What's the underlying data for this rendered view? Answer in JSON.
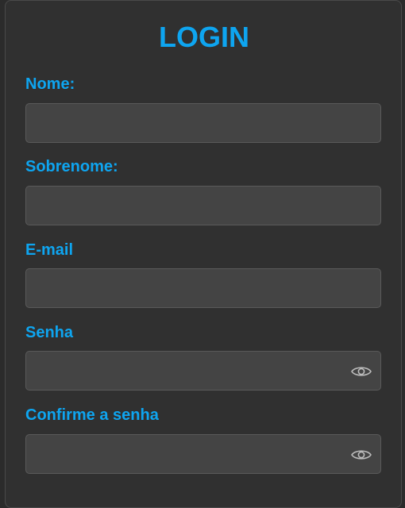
{
  "form": {
    "title": "LOGIN",
    "fields": [
      {
        "label": "Nome:",
        "value": "",
        "placeholder": ""
      },
      {
        "label": "Sobrenome:",
        "value": "",
        "placeholder": ""
      },
      {
        "label": "E-mail",
        "value": "",
        "placeholder": ""
      },
      {
        "label": "Senha",
        "value": "",
        "placeholder": "",
        "toggle_icon": "eye-icon"
      },
      {
        "label": "Confirme a senha",
        "value": "",
        "placeholder": "",
        "toggle_icon": "eye-icon"
      }
    ]
  },
  "colors": {
    "accent": "#0ea5f0",
    "card_background": "#303030",
    "input_background": "#444444"
  }
}
